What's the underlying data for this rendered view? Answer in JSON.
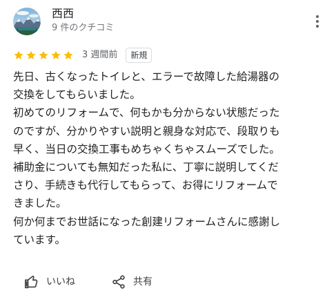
{
  "reviewer": {
    "name": "西西",
    "meta": "9 件のクチコミ"
  },
  "rating": {
    "stars": 5,
    "max_stars": 5,
    "star_color": "#fbbc04",
    "time_ago": "3 週間前",
    "badge": "新規"
  },
  "review": {
    "lines": [
      "先日、古くなったトイレと、エラーで故障した給湯器の",
      "交換をしてもらいました。",
      "初めてのリフォームで、何もかも分からない状態だった",
      "のですが、分かりやすい説明と親身な対応で、段取りも",
      "早く、当日の交換工事もめちゃくちゃスムーズでした。",
      "補助金についても無知だった私に、丁寧に説明してくだ",
      "さり、手続きも代行してもらって、お得にリフォームで",
      "きました。",
      "何か何までお世話になった創建リフォームさんに感謝し",
      "ています。"
    ]
  },
  "actions": {
    "like_label": "いいね",
    "like_icon": "thumbs-up-icon",
    "share_label": "共有",
    "share_icon": "share-icon"
  },
  "header": {
    "more_icon": "more-vert-icon"
  }
}
